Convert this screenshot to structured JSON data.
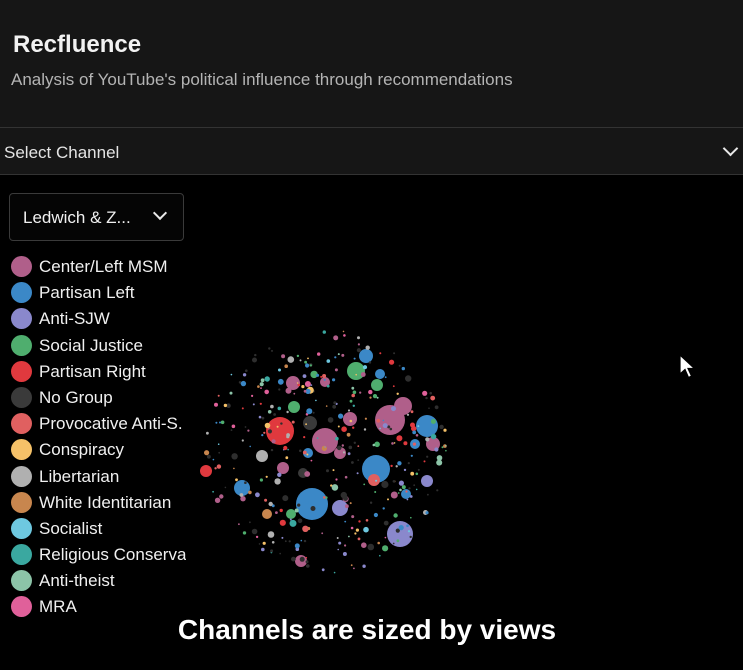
{
  "header": {
    "title": "Recfluence",
    "subtitle": "Analysis of YouTube's political influence through recommendations"
  },
  "channel_select": {
    "label": "Select Channel"
  },
  "classification_dropdown": {
    "value": "Ledwich & Z..."
  },
  "legend": [
    {
      "label": "Center/Left MSM",
      "color": "#b05f8a"
    },
    {
      "label": "Partisan Left",
      "color": "#3b88c7"
    },
    {
      "label": "Anti-SJW",
      "color": "#8a88cc"
    },
    {
      "label": "Social Justice",
      "color": "#4fae6e"
    },
    {
      "label": "Partisan Right",
      "color": "#e0393e"
    },
    {
      "label": "No Group",
      "color": "#3a3a3a"
    },
    {
      "label": "Provocative Anti-S.",
      "color": "#e06060"
    },
    {
      "label": "Conspiracy",
      "color": "#f5c168"
    },
    {
      "label": "Libertarian",
      "color": "#b0b0b0"
    },
    {
      "label": "White Identitarian",
      "color": "#c8864e"
    },
    {
      "label": "Socialist",
      "color": "#6ec8e0"
    },
    {
      "label": "Religious Conserva",
      "color": "#3aa8a0"
    },
    {
      "label": "Anti-theist",
      "color": "#8cc4a8"
    },
    {
      "label": "MRA",
      "color": "#e0609a"
    }
  ],
  "caption": "Channels are sized by views"
}
